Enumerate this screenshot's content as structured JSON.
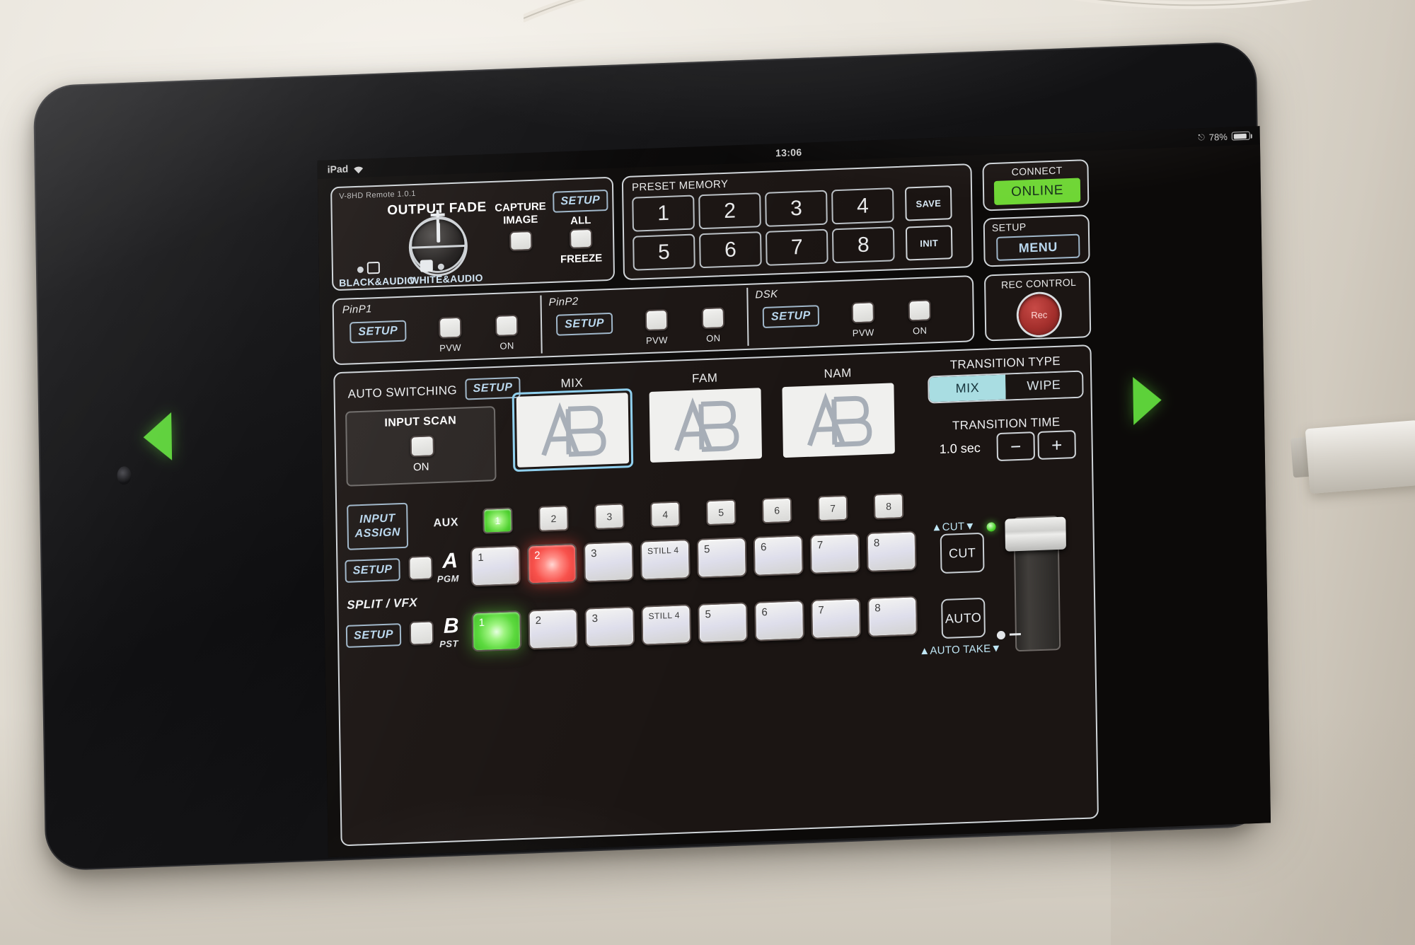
{
  "device": {
    "name": "iPad"
  },
  "statusbar": {
    "carrier": "iPad",
    "wifi_icon": "wifi-icon",
    "time": "13:06",
    "lock_icon": "rotation-lock-icon",
    "battery_percent": "78%",
    "battery_icon": "battery-icon"
  },
  "app": {
    "version_label": "V-8HD Remote 1.0.1"
  },
  "output_fade": {
    "title": "OUTPUT FADE",
    "left_label": "BLACK&AUDIO",
    "right_label": "WHITE&AUDIO"
  },
  "capture": {
    "title_line1": "CAPTURE",
    "title_line2": "IMAGE"
  },
  "capture_setup": {
    "setup_label": "SETUP",
    "all_label": "ALL",
    "freeze_label": "FREEZE"
  },
  "preset_memory": {
    "title": "PRESET MEMORY",
    "buttons": [
      "1",
      "2",
      "3",
      "4",
      "5",
      "6",
      "7",
      "8"
    ],
    "save_label": "SAVE",
    "init_label": "INIT"
  },
  "connect": {
    "title": "CONNECT",
    "status": "ONLINE",
    "status_color": "#6fd635"
  },
  "setup_menu": {
    "title": "SETUP",
    "button": "MENU"
  },
  "pinp1": {
    "title": "PinP1",
    "setup": "SETUP",
    "pvw": "PVW",
    "on": "ON"
  },
  "pinp2": {
    "title": "PinP2",
    "setup": "SETUP",
    "pvw": "PVW",
    "on": "ON"
  },
  "dsk": {
    "title": "DSK",
    "setup": "SETUP",
    "pvw": "PVW",
    "on": "ON"
  },
  "rec_control": {
    "title": "REC CONTROL",
    "button": "Rec"
  },
  "auto_switching": {
    "title": "AUTO SWITCHING",
    "setup": "SETUP",
    "input_scan": "INPUT SCAN",
    "on": "ON"
  },
  "previews": [
    {
      "caption": "MIX",
      "selected": true
    },
    {
      "caption": "FAM",
      "selected": false
    },
    {
      "caption": "NAM",
      "selected": false
    }
  ],
  "transition": {
    "type_title": "TRANSITION TYPE",
    "type_options": [
      "MIX",
      "WIPE"
    ],
    "type_selected": "MIX",
    "time_title": "TRANSITION TIME",
    "time_value": "1.0 sec",
    "minus": "−",
    "plus": "+"
  },
  "input_assign": {
    "line1": "INPUT",
    "line2": "ASSIGN"
  },
  "aux": {
    "label": "AUX",
    "buttons": [
      "1",
      "2",
      "3",
      "4",
      "5",
      "6",
      "7",
      "8"
    ],
    "active_index": 0
  },
  "bus_a": {
    "setup": "SETUP",
    "letter": "A",
    "sub": "PGM",
    "buttons": [
      "1",
      "2",
      "3",
      "STILL 4",
      "5",
      "6",
      "7",
      "8"
    ],
    "active_index": 1,
    "active_color": "#f8504a"
  },
  "bus_b": {
    "setup": "SETUP",
    "letter": "B",
    "sub": "PST",
    "buttons": [
      "1",
      "2",
      "3",
      "STILL 4",
      "5",
      "6",
      "7",
      "8"
    ],
    "active_index": 0,
    "active_color": "#5ad93c"
  },
  "split_vfx": {
    "label": "SPLIT / VFX"
  },
  "cut_auto": {
    "cut_top": "▲CUT▼",
    "cut_button": "CUT",
    "auto_button": "AUTO",
    "auto_take": "▲AUTO TAKE▼"
  },
  "page_nav": {
    "prev_icon": "triangle-left-icon",
    "next_icon": "triangle-right-icon",
    "color": "#5dd13a"
  }
}
